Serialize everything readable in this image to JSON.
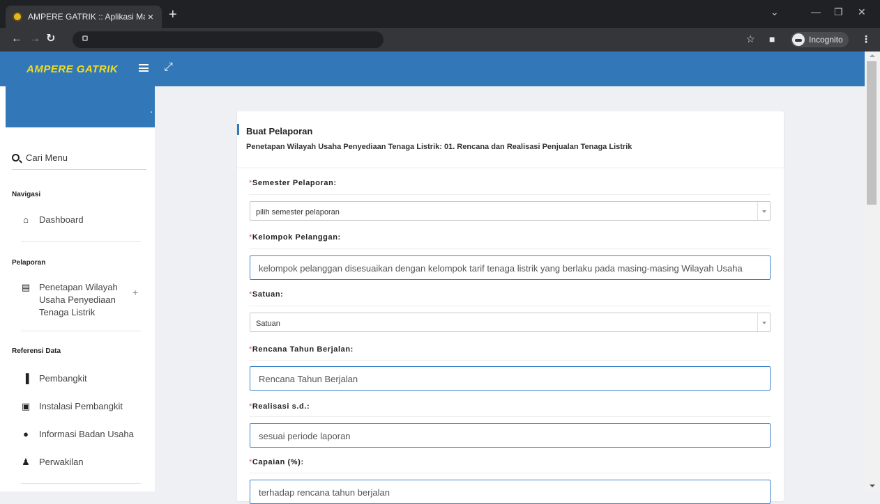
{
  "browser": {
    "tab_title": "AMPERE GATRIK :: Aplikasi Mana",
    "tab_close": "×",
    "new_tab": "+",
    "incognito_label": "Incognito"
  },
  "app": {
    "brand": "AMPERE GATRIK"
  },
  "sidebar": {
    "search_label": "Cari Menu",
    "sections": {
      "navigasi": "Navigasi",
      "pelaporan": "Pelaporan",
      "referensi": "Referensi Data"
    },
    "items": {
      "dashboard": "Dashboard",
      "penetapan_line1": "Penetapan Wilayah",
      "penetapan_line2": "Usaha Penyediaan",
      "penetapan_line3": "Tenaga Listrik",
      "pembangkit": "Pembangkit",
      "instalasi": "Instalasi Pembangkit",
      "informasi": "Informasi Badan Usaha",
      "perwakilan": "Perwakilan"
    },
    "expand_symbol": "+"
  },
  "form": {
    "title": "Buat Pelaporan",
    "subtitle": "Penetapan Wilayah Usaha Penyediaan Tenaga Listrik: 01. Rencana dan Realisasi Penjualan Tenaga Listrik",
    "required_mark": "*",
    "fields": {
      "semester_label": "Semester Pelaporan:",
      "semester_value": "pilih semester pelaporan",
      "kelompok_label": "Kelompok Pelanggan:",
      "kelompok_placeholder": "kelompok pelanggan disesuaikan dengan kelompok tarif tenaga listrik yang berlaku pada masing-masing Wilayah Usaha",
      "satuan_label": "Satuan:",
      "satuan_value": "Satuan",
      "rencana_label": "Rencana Tahun Berjalan:",
      "rencana_placeholder": "Rencana Tahun Berjalan",
      "realisasi_label": "Realisasi s.d.:",
      "realisasi_placeholder": "sesuai periode laporan",
      "capaian_label": "Capaian (%):",
      "capaian_placeholder": "terhadap rencana tahun berjalan"
    }
  },
  "colors": {
    "primary": "#3278b9",
    "brand_text": "#f2dd1f",
    "required": "#e05a5a"
  }
}
